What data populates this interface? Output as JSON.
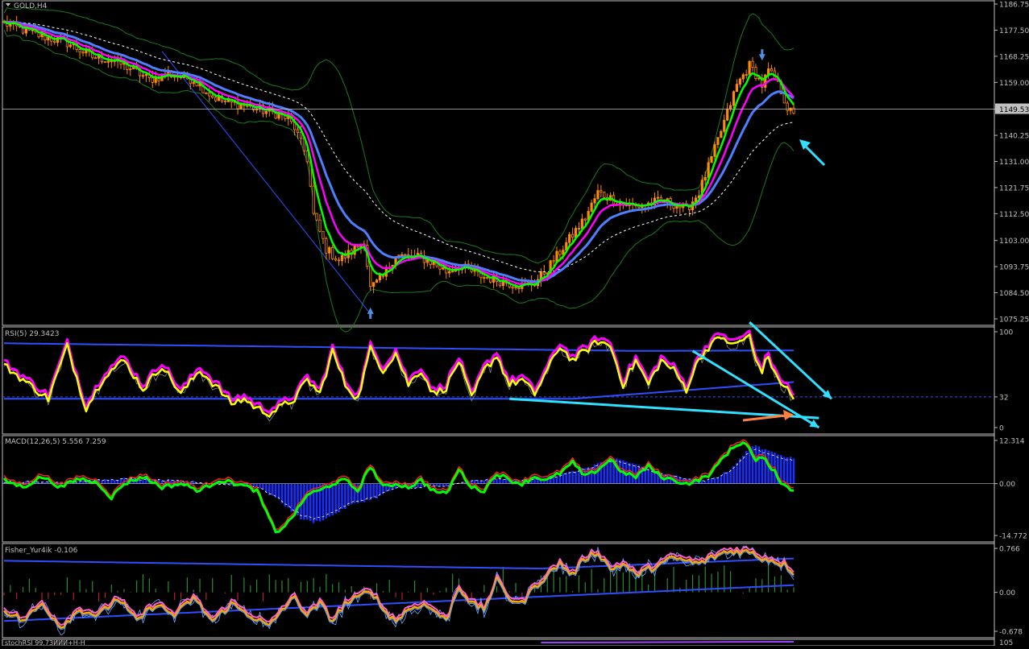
{
  "colors": {
    "background": "#000000",
    "frame": "#c0c0c0",
    "scale_text": "#c0c0c0",
    "bull_candle": "#ff8c00",
    "bear_candle": "#ff8c00",
    "ma_fast": "#00ff00",
    "ma_mid": "#ff00ff",
    "ma_slow": "#4d7fff",
    "ma_dashed": "#ffffff",
    "bands": "#1a7a1a",
    "channel": "#2f4fff",
    "rsi_main": "#ffff00",
    "rsi_ma": "#ff00ff",
    "macd_line": "#00ff00",
    "macd_signal": "#ff2020",
    "macd_hist": "#1a2eff",
    "fisher_main": "#ffa500",
    "fisher_hist_up": "#2e8b2e",
    "fisher_hist_dn": "#b22222",
    "annot_cyan": "#2fe0ff",
    "annot_orange": "#ff8040",
    "last_price_box": "#c0c0c0"
  },
  "chart_data": [
    {
      "type": "candlestick",
      "title": "GOLD,H4",
      "ylim": [
        1075.25,
        1186.75
      ],
      "yticks": [
        "1186.75",
        "1177.50",
        "1168.25",
        "1159.00",
        "1149.53",
        "1140.25",
        "1131.00",
        "1121.75",
        "1112.50",
        "1103.00",
        "1093.75",
        "1084.50",
        "1075.25"
      ],
      "last_price": "1149.53",
      "overlays": [
        "Bollinger bands",
        "moving averages",
        "trend channel"
      ],
      "close_path": [
        [
          0,
          1180
        ],
        [
          10,
          1176
        ],
        [
          20,
          1173
        ],
        [
          28,
          1168
        ],
        [
          34,
          1167
        ],
        [
          40,
          1164
        ],
        [
          46,
          1160
        ],
        [
          52,
          1162
        ],
        [
          60,
          1160
        ],
        [
          66,
          1154
        ],
        [
          70,
          1152
        ],
        [
          76,
          1151
        ],
        [
          82,
          1149
        ],
        [
          86,
          1148
        ],
        [
          90,
          1146
        ],
        [
          92,
          1143
        ],
        [
          96,
          1132
        ],
        [
          98,
          1112
        ],
        [
          102,
          1100
        ],
        [
          106,
          1096
        ],
        [
          110,
          1099
        ],
        [
          114,
          1103
        ],
        [
          116,
          1086
        ],
        [
          120,
          1090
        ],
        [
          124,
          1098
        ],
        [
          128,
          1097
        ],
        [
          132,
          1097
        ],
        [
          136,
          1095
        ],
        [
          140,
          1092
        ],
        [
          144,
          1094
        ],
        [
          148,
          1092
        ],
        [
          152,
          1090
        ],
        [
          156,
          1089
        ],
        [
          160,
          1088
        ],
        [
          164,
          1087
        ],
        [
          168,
          1088
        ],
        [
          172,
          1093
        ],
        [
          176,
          1099
        ],
        [
          180,
          1105
        ],
        [
          184,
          1111
        ],
        [
          188,
          1120
        ],
        [
          192,
          1118
        ],
        [
          196,
          1116
        ],
        [
          200,
          1115
        ],
        [
          204,
          1116
        ],
        [
          208,
          1117
        ],
        [
          212,
          1116
        ],
        [
          216,
          1114
        ],
        [
          220,
          1120
        ],
        [
          224,
          1132
        ],
        [
          228,
          1145
        ],
        [
          232,
          1158
        ],
        [
          236,
          1165
        ],
        [
          238,
          1162
        ],
        [
          240,
          1158
        ],
        [
          242,
          1163
        ],
        [
          244,
          1160
        ],
        [
          246,
          1156
        ],
        [
          248,
          1150
        ],
        [
          250,
          1147
        ]
      ],
      "markers": [
        {
          "bar": 116,
          "type": "up-arrow",
          "price": 1077
        },
        {
          "bar": 240,
          "type": "down-arrow",
          "price": 1169
        }
      ],
      "annotations": [
        {
          "type": "arrow",
          "direction": "up-left",
          "color": "cyan"
        }
      ]
    },
    {
      "type": "line",
      "title": "RSI(5) 29.3423",
      "ylim": [
        0,
        100
      ],
      "yticks": [
        "100",
        "32",
        "0"
      ],
      "level": 32,
      "series": [
        {
          "name": "RSI(5)",
          "points": [
            [
              0,
              65
            ],
            [
              8,
              45
            ],
            [
              14,
              30
            ],
            [
              20,
              85
            ],
            [
              26,
              20
            ],
            [
              32,
              55
            ],
            [
              38,
              70
            ],
            [
              44,
              40
            ],
            [
              50,
              65
            ],
            [
              56,
              35
            ],
            [
              62,
              60
            ],
            [
              68,
              40
            ],
            [
              72,
              25
            ],
            [
              76,
              30
            ],
            [
              80,
              20
            ],
            [
              84,
              15
            ],
            [
              88,
              22
            ],
            [
              92,
              30
            ],
            [
              96,
              50
            ],
            [
              100,
              35
            ],
            [
              104,
              80
            ],
            [
              108,
              45
            ],
            [
              112,
              30
            ],
            [
              116,
              82
            ],
            [
              120,
              60
            ],
            [
              124,
              78
            ],
            [
              128,
              45
            ],
            [
              132,
              60
            ],
            [
              136,
              35
            ],
            [
              140,
              42
            ],
            [
              144,
              70
            ],
            [
              148,
              30
            ],
            [
              152,
              60
            ],
            [
              156,
              75
            ],
            [
              160,
              45
            ],
            [
              164,
              50
            ],
            [
              168,
              35
            ],
            [
              172,
              60
            ],
            [
              176,
              85
            ],
            [
              180,
              70
            ],
            [
              184,
              80
            ],
            [
              188,
              90
            ],
            [
              192,
              85
            ],
            [
              196,
              45
            ],
            [
              200,
              70
            ],
            [
              204,
              45
            ],
            [
              208,
              70
            ],
            [
              212,
              60
            ],
            [
              216,
              40
            ],
            [
              220,
              72
            ],
            [
              224,
              88
            ],
            [
              228,
              95
            ],
            [
              230,
              85
            ],
            [
              234,
              92
            ],
            [
              236,
              95
            ],
            [
              238,
              70
            ],
            [
              240,
              60
            ],
            [
              242,
              75
            ],
            [
              244,
              55
            ],
            [
              248,
              40
            ],
            [
              250,
              29
            ]
          ]
        }
      ],
      "annotations": [
        {
          "type": "trendline",
          "color": "cyan",
          "from": [
            160,
            30
          ],
          "to": [
            258,
            10
          ]
        },
        {
          "type": "arrow",
          "color": "cyan",
          "from": [
            218,
            80
          ],
          "to": [
            258,
            0
          ]
        },
        {
          "type": "arrow",
          "color": "cyan",
          "from": [
            236,
            110
          ],
          "to": [
            262,
            30
          ]
        },
        {
          "type": "arrow",
          "color": "orange",
          "direction": "right"
        }
      ]
    },
    {
      "type": "bar+line",
      "title": "MACD(12,26,5) 5.556 7.259",
      "ylim": [
        -14.772,
        12.314
      ],
      "yticks": [
        "12.314",
        "0.00",
        "-14.772"
      ],
      "histogram": [
        [
          0,
          0.5
        ],
        [
          20,
          0.5
        ],
        [
          40,
          1.5
        ],
        [
          60,
          0.5
        ],
        [
          80,
          -1
        ],
        [
          86,
          -4
        ],
        [
          90,
          -7
        ],
        [
          94,
          -10
        ],
        [
          98,
          -11
        ],
        [
          102,
          -10
        ],
        [
          106,
          -8
        ],
        [
          110,
          -6
        ],
        [
          114,
          -5
        ],
        [
          118,
          -4
        ],
        [
          122,
          -2
        ],
        [
          126,
          -1
        ],
        [
          130,
          -1.5
        ],
        [
          134,
          -0.5
        ],
        [
          138,
          -1
        ],
        [
          142,
          -0.5
        ],
        [
          146,
          0.5
        ],
        [
          150,
          1
        ],
        [
          154,
          1.2
        ],
        [
          158,
          1.5
        ],
        [
          162,
          1
        ],
        [
          166,
          1.2
        ],
        [
          170,
          1.5
        ],
        [
          174,
          2
        ],
        [
          178,
          3
        ],
        [
          182,
          4
        ],
        [
          186,
          5
        ],
        [
          190,
          6.5
        ],
        [
          194,
          7
        ],
        [
          198,
          6
        ],
        [
          202,
          5
        ],
        [
          206,
          3.5
        ],
        [
          210,
          2.5
        ],
        [
          214,
          2
        ],
        [
          218,
          1.5
        ],
        [
          222,
          1
        ],
        [
          226,
          2
        ],
        [
          230,
          4
        ],
        [
          234,
          8
        ],
        [
          236,
          10
        ],
        [
          238,
          11
        ],
        [
          240,
          10
        ],
        [
          242,
          9.5
        ],
        [
          244,
          9
        ],
        [
          246,
          8
        ],
        [
          248,
          7.5
        ],
        [
          250,
          7.259
        ]
      ],
      "macd_line": [
        [
          0,
          1
        ],
        [
          6,
          -1
        ],
        [
          12,
          2
        ],
        [
          18,
          -1
        ],
        [
          24,
          1.5
        ],
        [
          30,
          0
        ],
        [
          34,
          -4
        ],
        [
          38,
          0
        ],
        [
          44,
          2
        ],
        [
          50,
          -1
        ],
        [
          56,
          0
        ],
        [
          62,
          -2
        ],
        [
          68,
          1
        ],
        [
          74,
          0
        ],
        [
          80,
          -2
        ],
        [
          84,
          -10
        ],
        [
          86,
          -14
        ],
        [
          90,
          -11
        ],
        [
          94,
          -6
        ],
        [
          96,
          -3
        ],
        [
          100,
          -2
        ],
        [
          104,
          0
        ],
        [
          108,
          1
        ],
        [
          112,
          -2
        ],
        [
          116,
          5
        ],
        [
          120,
          -1
        ],
        [
          124,
          0
        ],
        [
          128,
          -1
        ],
        [
          132,
          1
        ],
        [
          136,
          -2
        ],
        [
          140,
          -3
        ],
        [
          144,
          4
        ],
        [
          148,
          -1
        ],
        [
          152,
          -2
        ],
        [
          156,
          3
        ],
        [
          160,
          1
        ],
        [
          164,
          0
        ],
        [
          168,
          2
        ],
        [
          172,
          1
        ],
        [
          176,
          3
        ],
        [
          180,
          6
        ],
        [
          184,
          2
        ],
        [
          188,
          4
        ],
        [
          192,
          7
        ],
        [
          196,
          3
        ],
        [
          200,
          2
        ],
        [
          204,
          5
        ],
        [
          208,
          2
        ],
        [
          212,
          1
        ],
        [
          216,
          0
        ],
        [
          220,
          1
        ],
        [
          224,
          3
        ],
        [
          228,
          8
        ],
        [
          232,
          11
        ],
        [
          234,
          12
        ],
        [
          236,
          10
        ],
        [
          238,
          6
        ],
        [
          240,
          8
        ],
        [
          242,
          5
        ],
        [
          244,
          4
        ],
        [
          246,
          0
        ],
        [
          250,
          -2
        ]
      ]
    },
    {
      "type": "line",
      "title": "Fisher_Yur4ik -0.106",
      "ylim": [
        -0.678,
        0.766
      ],
      "yticks": [
        "0.766",
        "0.00",
        "-0.678"
      ],
      "series": [
        {
          "name": "Fisher_Yur4ik",
          "points": [
            [
              0,
              -0.3
            ],
            [
              6,
              -0.5
            ],
            [
              12,
              -0.2
            ],
            [
              18,
              -0.6
            ],
            [
              24,
              -0.3
            ],
            [
              30,
              -0.4
            ],
            [
              36,
              -0.1
            ],
            [
              42,
              -0.5
            ],
            [
              48,
              -0.2
            ],
            [
              54,
              -0.4
            ],
            [
              60,
              -0.1
            ],
            [
              66,
              -0.5
            ],
            [
              72,
              -0.2
            ],
            [
              78,
              -0.4
            ],
            [
              84,
              -0.6
            ],
            [
              88,
              -0.3
            ],
            [
              92,
              -0.1
            ],
            [
              96,
              -0.4
            ],
            [
              100,
              -0.2
            ],
            [
              104,
              -0.5
            ],
            [
              108,
              -0.2
            ],
            [
              112,
              -0.1
            ],
            [
              116,
              0.05
            ],
            [
              120,
              -0.3
            ],
            [
              124,
              -0.5
            ],
            [
              128,
              -0.3
            ],
            [
              132,
              -0.2
            ],
            [
              136,
              -0.3
            ],
            [
              140,
              -0.5
            ],
            [
              144,
              0.1
            ],
            [
              148,
              -0.2
            ],
            [
              152,
              -0.3
            ],
            [
              156,
              0.2
            ],
            [
              160,
              -0.1
            ],
            [
              164,
              -0.2
            ],
            [
              168,
              0.1
            ],
            [
              172,
              0.3
            ],
            [
              176,
              0.5
            ],
            [
              180,
              0.3
            ],
            [
              184,
              0.6
            ],
            [
              188,
              0.7
            ],
            [
              192,
              0.4
            ],
            [
              196,
              0.5
            ],
            [
              200,
              0.3
            ],
            [
              204,
              0.4
            ],
            [
              208,
              0.5
            ],
            [
              212,
              0.6
            ],
            [
              216,
              0.55
            ],
            [
              220,
              0.5
            ],
            [
              224,
              0.6
            ],
            [
              228,
              0.7
            ],
            [
              232,
              0.72
            ],
            [
              236,
              0.7
            ],
            [
              240,
              0.6
            ],
            [
              244,
              0.55
            ],
            [
              248,
              0.45
            ],
            [
              250,
              0.35
            ]
          ]
        }
      ]
    },
    {
      "type": "line",
      "title": "stochRSI 99.7ЗИИИ+Н-Н",
      "yticks": [
        "105"
      ]
    }
  ]
}
